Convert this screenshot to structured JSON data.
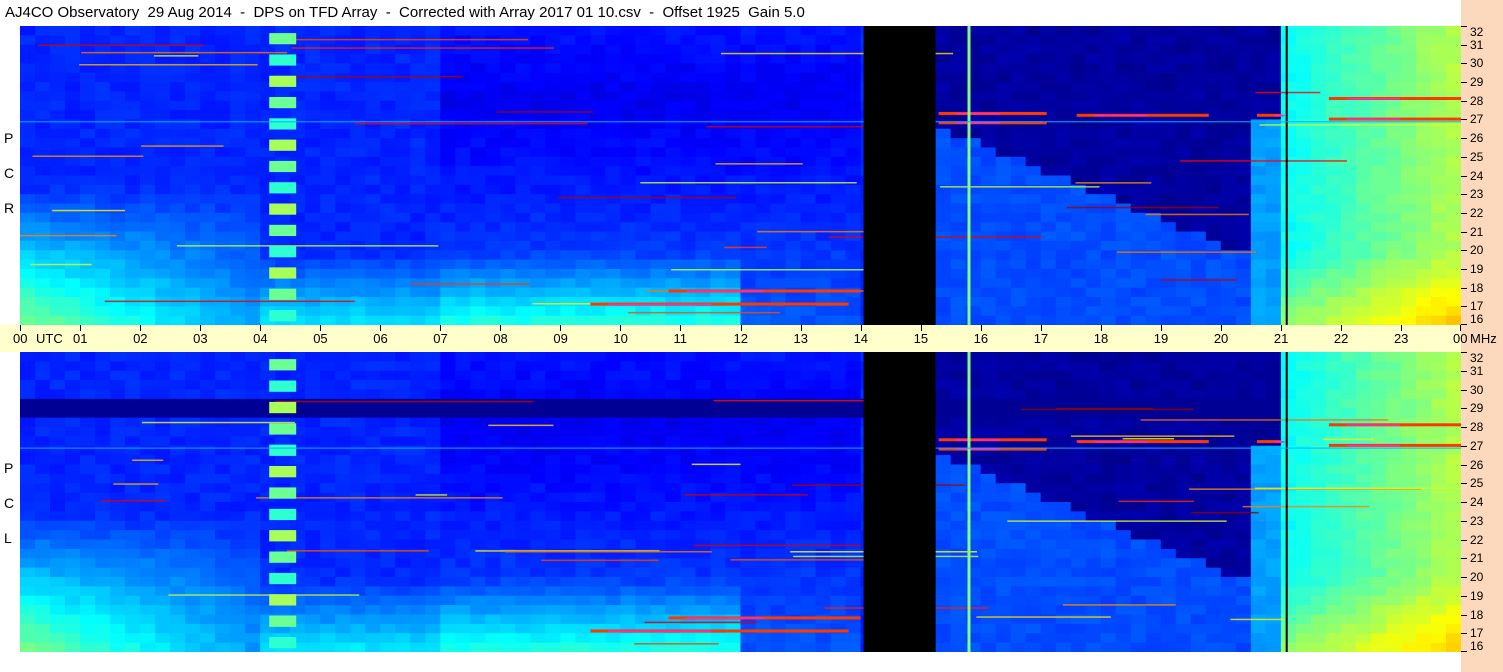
{
  "title": "AJ4CO Observatory  29 Aug 2014  -  DPS on TFD Array  -  Corrected with Array 2017 01 10.csv  -  Offset 1925  Gain 5.0",
  "colors": {
    "accent_strip": "#fcd9bc",
    "axis_band": "#ffffcc",
    "spectrogram_base": "#1040e0",
    "data_gap": "#000000"
  },
  "chart_data": [
    {
      "type": "heatmap",
      "polarization_label": [
        "R",
        "C",
        "P"
      ],
      "x_axis": {
        "unit": "UTC",
        "range": [
          0,
          24
        ],
        "tick_labels": [
          "00",
          "01",
          "02",
          "03",
          "04",
          "05",
          "06",
          "07",
          "08",
          "09",
          "10",
          "11",
          "12",
          "13",
          "14",
          "15",
          "16",
          "17",
          "18",
          "19",
          "20",
          "21",
          "22",
          "23",
          "00"
        ]
      },
      "y_axis": {
        "unit": "MHz",
        "range": [
          16,
          32
        ],
        "tick_labels": [
          "16",
          "17",
          "18",
          "19",
          "20",
          "21",
          "22",
          "23",
          "24",
          "25",
          "26",
          "27",
          "28",
          "29",
          "30",
          "31",
          "32"
        ]
      },
      "data_gap_utc": [
        14.05,
        15.25
      ],
      "colormap": "jet"
    },
    {
      "type": "heatmap",
      "polarization_label": [
        "L",
        "C",
        "P"
      ],
      "x_axis": {
        "unit": "UTC",
        "range": [
          0,
          24
        ],
        "tick_labels": [
          "00",
          "01",
          "02",
          "03",
          "04",
          "05",
          "06",
          "07",
          "08",
          "09",
          "10",
          "11",
          "12",
          "13",
          "14",
          "15",
          "16",
          "17",
          "18",
          "19",
          "20",
          "21",
          "22",
          "23",
          "00"
        ]
      },
      "y_axis": {
        "unit": "MHz",
        "range": [
          16,
          32
        ],
        "tick_labels": [
          "16",
          "17",
          "18",
          "19",
          "20",
          "21",
          "22",
          "23",
          "24",
          "25",
          "26",
          "27",
          "28",
          "29",
          "30",
          "31",
          "32"
        ]
      },
      "data_gap_utc": [
        14.05,
        15.25
      ],
      "colormap": "jet"
    }
  ],
  "axis_text": {
    "utc": "UTC",
    "mhz": "MHz"
  }
}
